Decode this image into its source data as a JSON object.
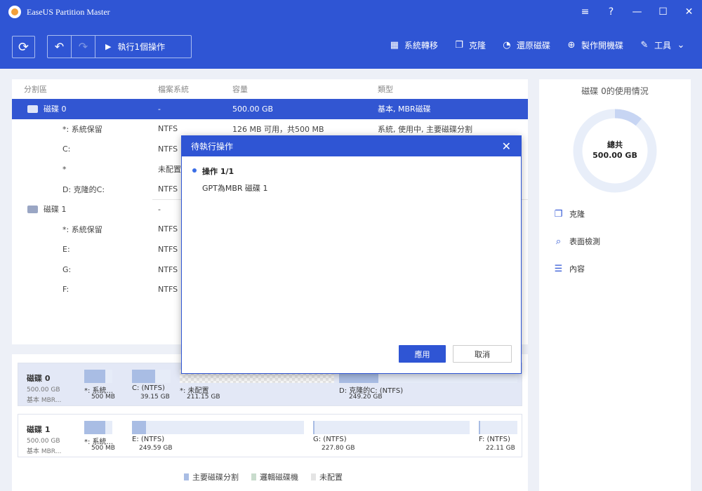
{
  "titlebar": {
    "title": "EaseUS Partition Master",
    "controls": [
      "≡",
      "?",
      "—",
      "☐",
      "✕"
    ]
  },
  "toolbar": {
    "undo_icon": "undo-icon",
    "redo_icon": "redo-icon",
    "execute_label": "執行1個操作",
    "items": [
      {
        "icon": "migrate-os-icon",
        "label": "系統轉移"
      },
      {
        "icon": "clone-icon",
        "label": "克隆"
      },
      {
        "icon": "restore-disk-icon",
        "label": "還原磁碟"
      },
      {
        "icon": "bootable-media-icon",
        "label": "製作開機碟"
      },
      {
        "icon": "tools-icon",
        "label": "工具"
      }
    ]
  },
  "partition_list": {
    "headers": [
      "分割區",
      "檔案系統",
      "容量",
      "類型"
    ],
    "rows": [
      {
        "kind": "disk",
        "name": "磁碟 0",
        "fs": "-",
        "capacity": "500.00 GB",
        "type": "基本, MBR磁碟",
        "selected": true
      },
      {
        "kind": "part",
        "name": "*: 系統保留",
        "fs": "NTFS",
        "capacity": "126 MB 可用，共500 MB",
        "type": "系統, 使用中, 主要磁碟分割"
      },
      {
        "kind": "part",
        "name": "C:",
        "fs": "NTFS",
        "capacity": "",
        "type": ""
      },
      {
        "kind": "part",
        "name": "*",
        "fs": "未配置",
        "capacity": "",
        "type": ""
      },
      {
        "kind": "part",
        "name": "D: 克隆的C:",
        "fs": "NTFS",
        "capacity": "",
        "type": ""
      },
      {
        "kind": "disk",
        "name": "磁碟 1",
        "fs": "-",
        "capacity": "",
        "type": ""
      },
      {
        "kind": "part",
        "name": "*: 系統保留",
        "fs": "NTFS",
        "capacity": "",
        "type": ""
      },
      {
        "kind": "part",
        "name": "E:",
        "fs": "NTFS",
        "capacity": "",
        "type": ""
      },
      {
        "kind": "part",
        "name": "G:",
        "fs": "NTFS",
        "capacity": "",
        "type": ""
      },
      {
        "kind": "part",
        "name": "F:",
        "fs": "NTFS",
        "capacity": "",
        "type": ""
      }
    ]
  },
  "disk_map": [
    {
      "name": "磁碟 0",
      "size": "500.00 GB",
      "type": "基本 MBR...",
      "partitions": [
        {
          "label": "*: 系統...",
          "size": "500 MB",
          "used": 0.75
        },
        {
          "label": "C: (NTFS)",
          "size": "39.15 GB",
          "used": 0.6
        },
        {
          "label": "*: 未配置",
          "size": "211.15 GB",
          "used": 0
        },
        {
          "label": "D: 克隆的C: (NTFS)",
          "size": "249.20 GB",
          "used": 0.22
        }
      ]
    },
    {
      "name": "磁碟 1",
      "size": "500.00 GB",
      "type": "基本 MBR...",
      "partitions": [
        {
          "label": "*: 系統...",
          "size": "500 MB",
          "used": 0.75
        },
        {
          "label": "E: (NTFS)",
          "size": "249.59 GB",
          "used": 0.08
        },
        {
          "label": "G: (NTFS)",
          "size": "227.80 GB",
          "used": 0.01
        },
        {
          "label": "F: (NTFS)",
          "size": "22.11 GB",
          "used": 0.03
        }
      ]
    }
  ],
  "legend": [
    {
      "label": "主要磁碟分割",
      "color": "#a9bde4"
    },
    {
      "label": "邏輯磁碟機",
      "color": "#c9dccd"
    },
    {
      "label": "未配置",
      "color": "#e4e4e4"
    }
  ],
  "right_panel": {
    "title": "磁碟 0的使用情況",
    "total_label": "總共",
    "total_value": "500.00 GB",
    "used_fraction": 0.11,
    "actions": [
      {
        "icon": "clone-icon",
        "label": "克隆"
      },
      {
        "icon": "surface-test-icon",
        "label": "表面檢測"
      },
      {
        "icon": "properties-icon",
        "label": "內容"
      }
    ]
  },
  "dialog": {
    "title": "待執行操作",
    "op_title": "操作 1/1",
    "op_desc": "GPT為MBR 磁碟 1",
    "apply_label": "應用",
    "cancel_label": "取消"
  },
  "colors": {
    "brand": "#2f55d4",
    "selection": "#3256d2"
  }
}
